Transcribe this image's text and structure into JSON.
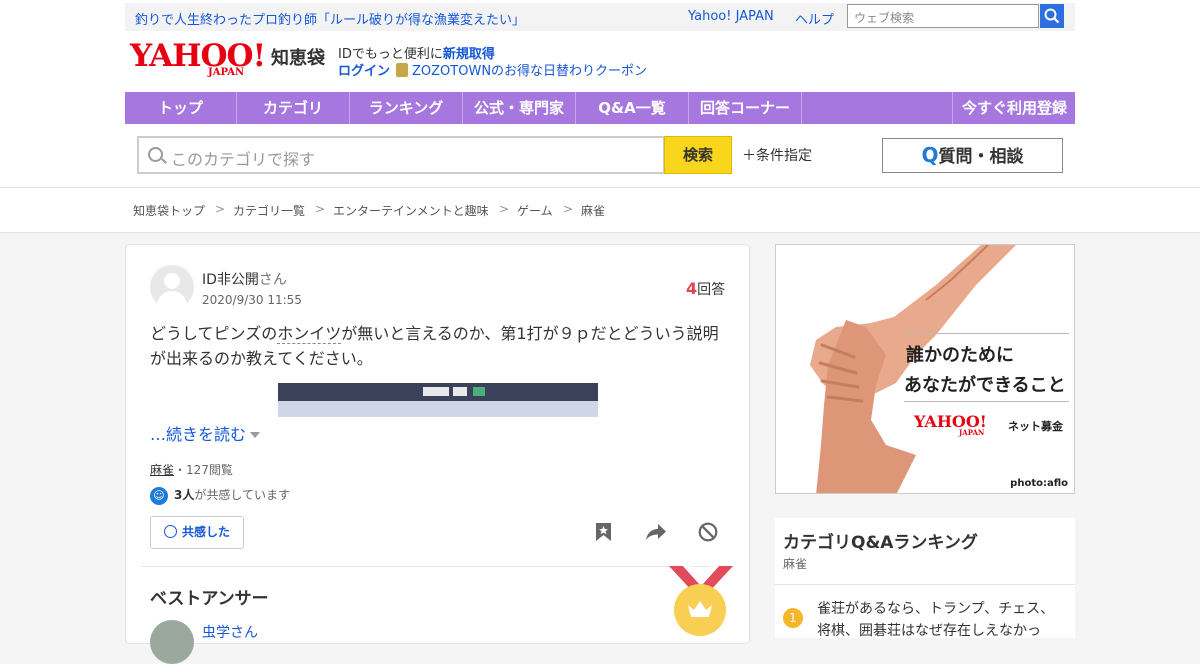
{
  "topbar": {
    "promo": "釣りで人生終わったプロ釣り師「ルール破りが得な漁業変えたい」",
    "yahoo_japan": "Yahoo! JAPAN",
    "help": "ヘルプ",
    "web_search_placeholder": "ウェブ検索"
  },
  "brand": {
    "logo_text": "YAHOO!",
    "logo_sub": "JAPAN",
    "service": "知恵袋"
  },
  "account": {
    "id_text": "IDでもっと便利に",
    "register": "新規取得",
    "login": "ログイン",
    "promo": "ZOZOTOWNのお得な日替わりクーポン"
  },
  "nav": {
    "items": [
      "トップ",
      "カテゴリ",
      "ランキング",
      "公式・専門家",
      "Q&A一覧",
      "回答コーナー"
    ],
    "register": "今すぐ利用登録"
  },
  "search": {
    "placeholder": "このカテゴリで探す",
    "button": "検索",
    "conditions": "＋条件指定",
    "ask_q": "Q",
    "ask_label": "質問・相談"
  },
  "breadcrumb": [
    "知恵袋トップ",
    ">",
    "カテゴリ一覧",
    ">",
    "エンターテインメントと趣味",
    ">",
    "ゲーム",
    ">",
    "麻雀"
  ],
  "question": {
    "user": "ID非公開",
    "user_suffix": "さん",
    "date": "2020/9/30 11:55",
    "answer_count": "4",
    "answer_label": "回答",
    "text_before": "どうしてピンズの",
    "text_underlined": "ホンイツ",
    "text_after": "が無いと言えるのか、第1打が９ｐだとどういう説明が出来るのか教えてください。",
    "read_more": "…続きを読む",
    "tag": "麻雀",
    "views": "・127閲覧",
    "empathy_count": "3人",
    "empathy_text": "が共感しています",
    "empathy_button": "共感した"
  },
  "best_answer": {
    "label": "ベストアンサー",
    "user": "虫学さん"
  },
  "ad": {
    "line1": "誰かのために",
    "line2": "あなたができること",
    "brand": "YAHOO!",
    "brand_sub": "JAPAN",
    "service": "ネット募金",
    "credit": "photo:aflo"
  },
  "ranking": {
    "title": "カテゴリQ&Aランキング",
    "category": "麻雀",
    "items": [
      {
        "rank": "1",
        "text": "雀荘があるなら、トランプ、チェス、将棋、囲碁荘はなぜ存在しえなかっ"
      }
    ]
  },
  "colors": {
    "nav": "#a777e0",
    "search_button": "#f9d61b",
    "brand_red": "#e60012",
    "link": "#1558d6",
    "answer_count": "#e5444e"
  }
}
